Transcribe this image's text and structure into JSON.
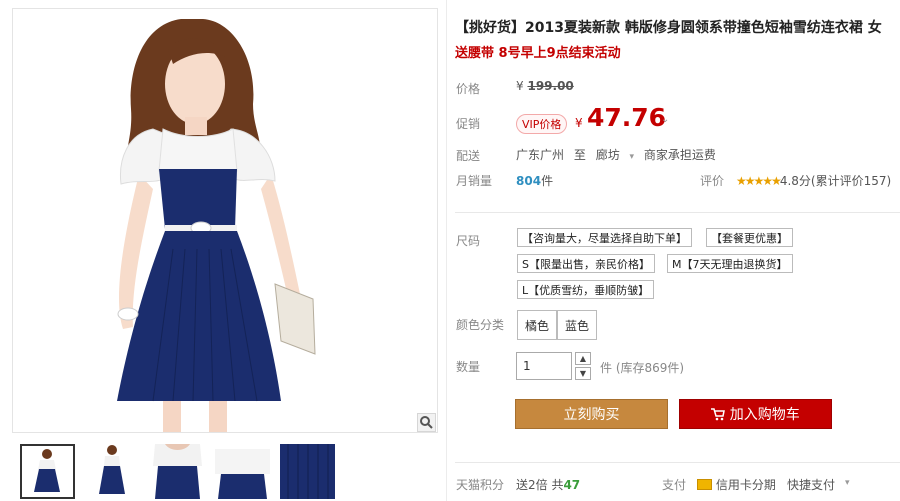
{
  "title": "【挑好货】2013夏装新款 韩版修身圆领系带撞色短袖雪纺连衣裙 女",
  "subtitle": "送腰带 8号早上9点结束活动",
  "price": {
    "label": "价格",
    "currency": "¥",
    "original": "199.00"
  },
  "promo": {
    "label": "促销",
    "vip": "VIP价格",
    "currency": "¥",
    "value": "47.76"
  },
  "shipping": {
    "label": "配送",
    "from": "广东广州",
    "to_word": "至",
    "dest": "廊坊",
    "note": "商家承担运费"
  },
  "sales": {
    "label": "月销量",
    "count": "804",
    "unit": "件"
  },
  "rating": {
    "label": "评价",
    "stars": "★★★★★",
    "score": "4.8分",
    "reviews": "(累计评价157)"
  },
  "size": {
    "label": "尺码",
    "options": [
      {
        "prefix": "",
        "text": "【咨询量大，尽量选择自助下单】"
      },
      {
        "prefix": "",
        "text": "【套餐更优惠】"
      },
      {
        "prefix": "S",
        "text": "【限量出售，亲民价格】"
      },
      {
        "prefix": "M",
        "text": "【7天无理由退换货】"
      },
      {
        "prefix": "L",
        "text": "【优质雪纺，垂顺防皱】"
      }
    ]
  },
  "color": {
    "label": "颜色分类",
    "options": [
      "橘色",
      "蓝色"
    ]
  },
  "quantity": {
    "label": "数量",
    "value": "1",
    "unit": "件",
    "stock": "(库存869件)"
  },
  "actions": {
    "buy": "立刻购买",
    "cart": "加入购物车"
  },
  "footer": {
    "points_label": "天猫积分",
    "points_text": "送2倍 共",
    "points_value": "47",
    "pay_label": "支付",
    "credit": "信用卡分期",
    "quick": "快捷支付"
  },
  "colors": {
    "accent": "#c40000",
    "buy": "#c6883e",
    "dress_navy": "#1b2d6e"
  },
  "icons": [
    "zoom-icon",
    "cart-icon",
    "credit-card-icon",
    "chevron-down-icon"
  ]
}
